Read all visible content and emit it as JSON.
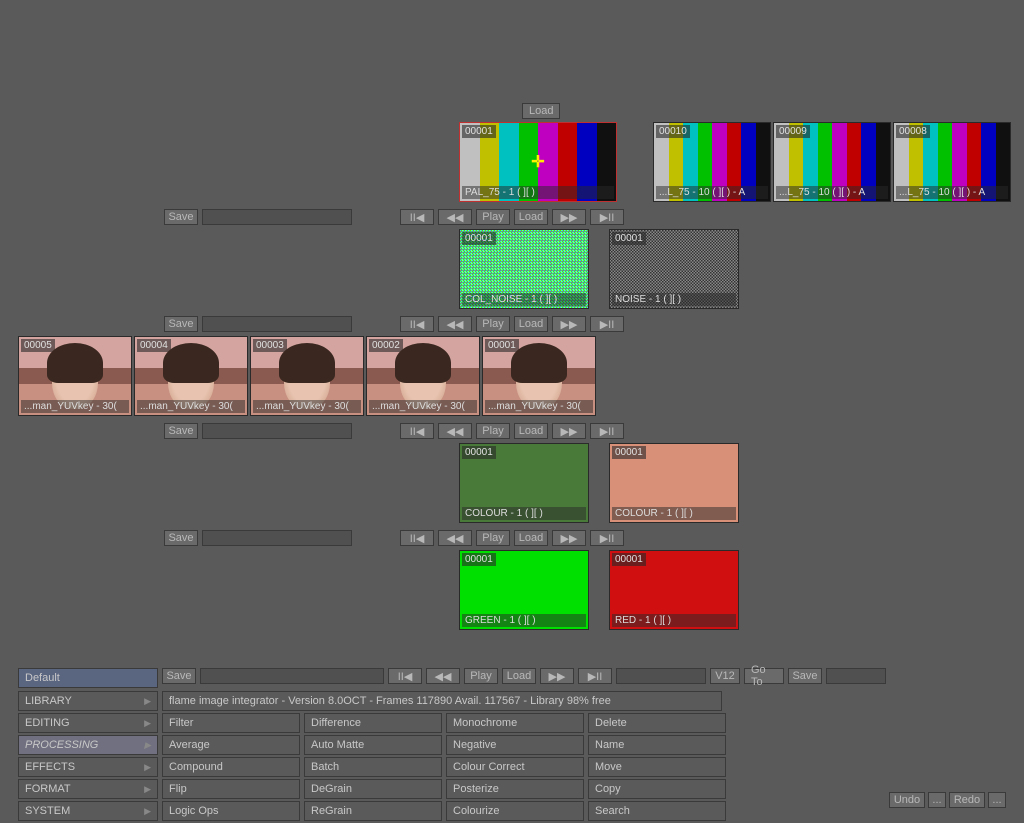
{
  "load_btn": "Load",
  "save_btn": "Save",
  "goto_btn": "Go To",
  "undo_btn": "Undo",
  "redo_btn": "Redo",
  "dots_btn": "...",
  "v_label": "V12",
  "transport": {
    "pause": "II◀",
    "rew": "◀◀",
    "play": "Play",
    "load": "Load",
    "ff": "▶▶",
    "playf": "▶II"
  },
  "clips": {
    "pal75_main": {
      "frame": "00001",
      "label": "PAL_75 - 1 ( ][ )"
    },
    "pal75_b": {
      "frame": "00010",
      "label": "...L_75 - 10 ( ][ ) - A"
    },
    "pal75_c": {
      "frame": "00009",
      "label": "...L_75 - 10 ( ][ ) - A"
    },
    "pal75_d": {
      "frame": "00008",
      "label": "...L_75 - 10 ( ][ ) - A"
    },
    "colnoise": {
      "frame": "00001",
      "label": "COL_NOISE - 1 ( ][ )"
    },
    "noise": {
      "frame": "00001",
      "label": "NOISE - 1 ( ][ )"
    },
    "yuv5": {
      "frame": "00005",
      "label": "...man_YUVkey - 30("
    },
    "yuv4": {
      "frame": "00004",
      "label": "...man_YUVkey - 30("
    },
    "yuv3": {
      "frame": "00003",
      "label": "...man_YUVkey - 30("
    },
    "yuv2": {
      "frame": "00002",
      "label": "...man_YUVkey - 30("
    },
    "yuv1": {
      "frame": "00001",
      "label": "...man_YUVkey - 30("
    },
    "colour_g": {
      "frame": "00001",
      "label": "COLOUR - 1 ( ][ )"
    },
    "colour_p": {
      "frame": "00001",
      "label": "COLOUR - 1 ( ][ )"
    },
    "green": {
      "frame": "00001",
      "label": "GREEN - 1 ( ][ )"
    },
    "red": {
      "frame": "00001",
      "label": "RED - 1 ( ][ )"
    }
  },
  "menu": {
    "default": "Default",
    "tabs": [
      "LIBRARY",
      "EDITING",
      "PROCESSING",
      "EFFECTS",
      "FORMAT",
      "SYSTEM"
    ],
    "status": "flame image integrator - Version 8.0OCT - Frames 117890 Avail. 117567 - Library 98% free",
    "grid": [
      [
        "Filter",
        "Difference",
        "Monochrome",
        "Delete"
      ],
      [
        "Average",
        "Auto Matte",
        "Negative",
        "Name"
      ],
      [
        "Compound",
        "Batch",
        "Colour Correct",
        "Move"
      ],
      [
        "Flip",
        "DeGrain",
        "Posterize",
        "Copy"
      ],
      [
        "Logic Ops",
        "ReGrain",
        "Colourize",
        "Search"
      ]
    ]
  }
}
